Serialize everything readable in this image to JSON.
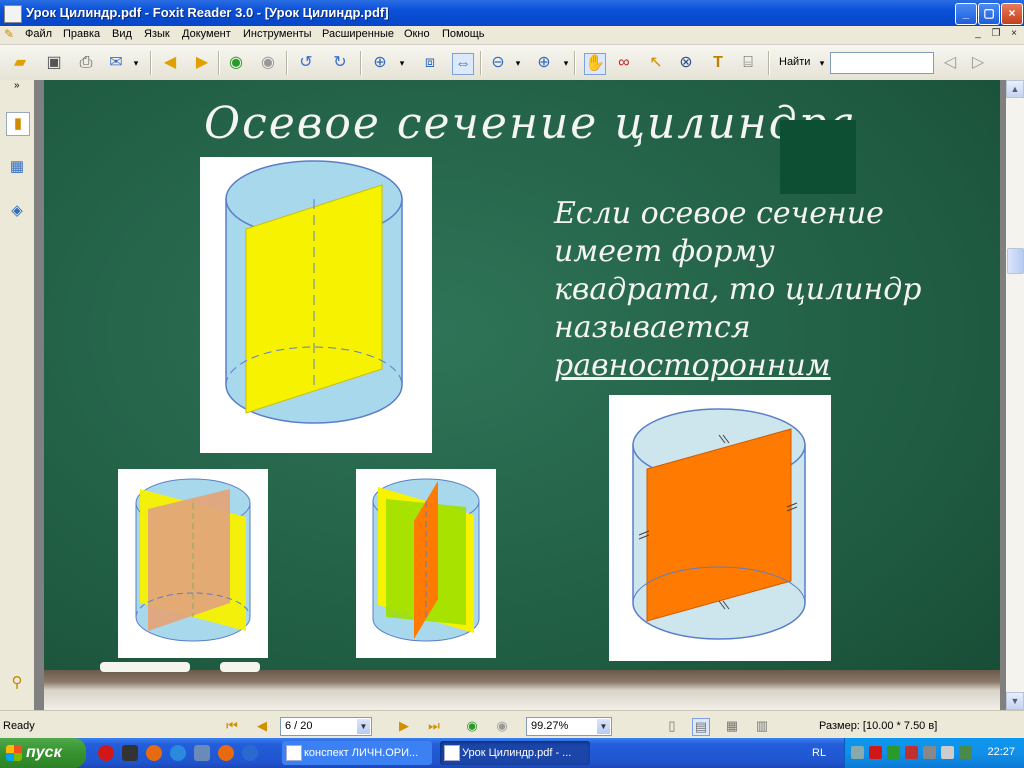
{
  "window": {
    "title": "Урок Цилиндр.pdf - Foxit Reader 3.0 - [Урок Цилиндр.pdf]",
    "min": "_",
    "max": "▢",
    "close": "×"
  },
  "menu": {
    "items": [
      "Файл",
      "Правка",
      "Вид",
      "Язык",
      "Документ",
      "Инструменты",
      "Расширенные",
      "Окно",
      "Помощь"
    ],
    "mdi_min": "_",
    "mdi_restore": "❐",
    "mdi_close": "×"
  },
  "toolbar": {
    "find_label": "Найти",
    "find_value": ""
  },
  "slide": {
    "title": "Осевое сечение цилиндра",
    "text_lines": [
      "Если осевое сечение",
      "имеет форму",
      "квадрата, то цилиндр",
      "называется"
    ],
    "text_underlined": "равносторонним"
  },
  "status": {
    "ready": "Ready",
    "page": "6 / 20",
    "zoom": "99.27%",
    "size": "Размер: [10.00 * 7.50 в]"
  },
  "taskbar": {
    "start": "пуск",
    "tasks": [
      "конспект ЛИЧН.ОРИ...",
      "Урок Цилиндр.pdf - ..."
    ],
    "lang": "RL",
    "clock": "22:27"
  },
  "colors": {
    "yellow": "#f7f200",
    "orange": "#ff7a00",
    "tan": "#e2a57a",
    "green": "#9ee000",
    "cyl_fill": "#a8d8ec",
    "board": "#25664a"
  }
}
